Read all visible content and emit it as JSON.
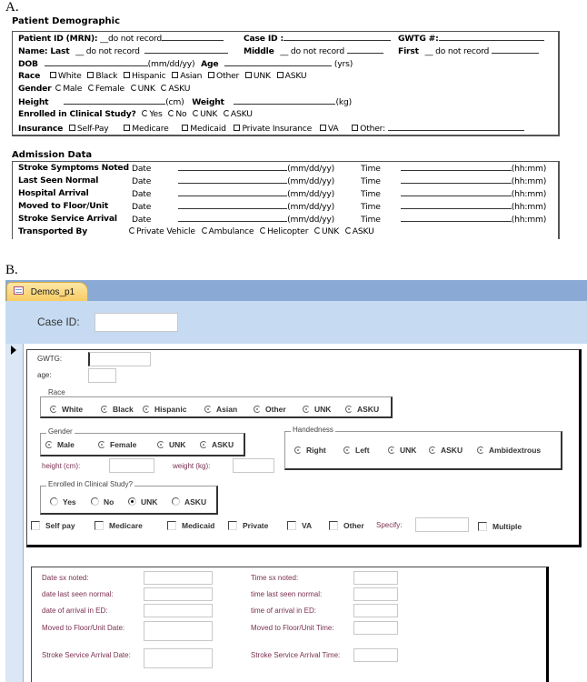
{
  "panelA": {
    "letter": "A.",
    "demographic": {
      "heading": "Patient Demographic",
      "patient_id_label": "Patient ID (MRN):",
      "patient_id_value": "__do not record",
      "case_id_label": "Case ID :",
      "gwtg_label": "GWTG #:",
      "name_label": "Name: Last",
      "last_value": "__ do not record",
      "middle_label": "Middle",
      "middle_value": "__ do not record",
      "first_label": "First",
      "first_value": "__ do not record",
      "dob_label": "DOB",
      "dob_unit": "(mm/dd/yy)",
      "age_label": "Age",
      "age_unit": "(yrs)",
      "race_label": "Race",
      "race_options": [
        "White",
        "Black",
        "Hispanic",
        "Asian",
        "Other",
        "UNK",
        "ASKU"
      ],
      "gender_label": "Gender",
      "gender_options": [
        "Male",
        "Female",
        "UNK",
        "ASKU"
      ],
      "height_label": "Height",
      "height_unit": "(cm)",
      "weight_label": "Weight",
      "weight_unit": "(kg)",
      "enrolled_label": "Enrolled in Clinical Study?",
      "enrolled_options": [
        "Yes",
        "No",
        "UNK",
        "ASKU"
      ],
      "insurance_label": "Insurance",
      "insurance_options": [
        "Self-Pay",
        "Medicare",
        "Medicaid",
        "Private Insurance",
        "VA",
        "Other:"
      ]
    },
    "admission": {
      "heading": "Admission Data",
      "date_label": "Date",
      "date_unit": "(mm/dd/yy)",
      "time_label": "Time",
      "time_unit": "(hh:mm)",
      "rows": [
        "Stroke Symptoms Noted",
        "Last Seen Normal",
        "Hospital Arrival",
        "Moved to Floor/Unit",
        "Stroke Service Arrival"
      ],
      "transported_label": "Transported By",
      "transported_options": [
        "Private Vehicle",
        "Ambulance",
        "Helicopter",
        "UNK",
        "ASKU"
      ]
    }
  },
  "panelB": {
    "letter": "B.",
    "tab_label": "Demos_p1",
    "case_id_label": "Case ID:",
    "case_id_value": "",
    "gwtg_label": "GWTG:",
    "gwtg_value": "",
    "age_label": "age:",
    "age_value": "",
    "race": {
      "caption": "Race",
      "options": [
        "White",
        "Black",
        "Hispanic",
        "Asian",
        "Other",
        "UNK",
        "ASKU"
      ]
    },
    "gender": {
      "caption": "Gender",
      "options": [
        "Male",
        "Female",
        "UNK",
        "ASKU"
      ]
    },
    "handedness": {
      "caption": "Handedness",
      "options": [
        "Right",
        "Left",
        "UNK",
        "ASKU",
        "Ambidextrous"
      ]
    },
    "height_label": "height (cm):",
    "height_value": "",
    "weight_label": "weight (kg):",
    "weight_value": "",
    "enrolled": {
      "caption": "Enrolled in Clinical Study?",
      "options": [
        "Yes",
        "No",
        "UNK",
        "ASKU"
      ],
      "selected": "UNK"
    },
    "insurance": {
      "options": [
        "Self pay",
        "Medicare",
        "Medicaid",
        "Private",
        "VA",
        "Other"
      ],
      "specify_label": "Specify:",
      "specify_value": "",
      "multiple_label": "Multiple"
    },
    "admission": {
      "date_labels": [
        "Date sx noted:",
        "date last seen normal:",
        "date of arrival in ED:",
        "Moved to Floor/Unit Date:",
        "Stroke Service Arrival Date:"
      ],
      "time_labels": [
        "Time sx noted:",
        "time last seen normal:",
        "time of arrival in ED:",
        "Moved to Floor/Unit Time:",
        "Stroke Service Arrival Time:"
      ]
    }
  }
}
